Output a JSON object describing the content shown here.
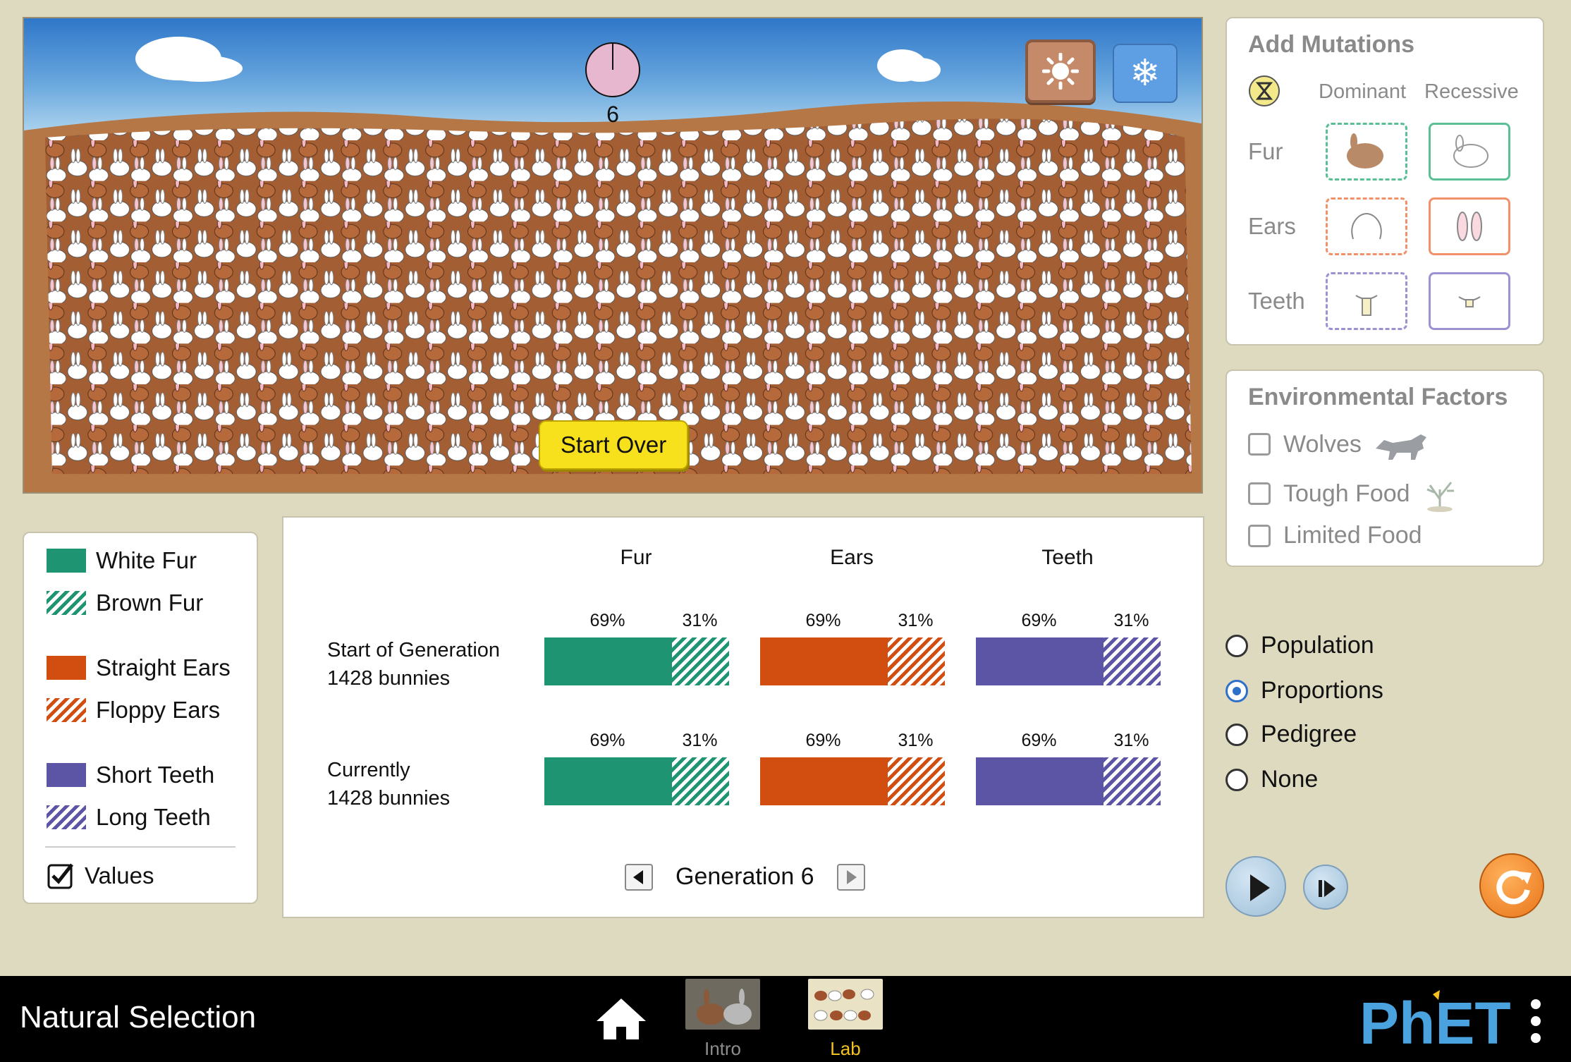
{
  "scene": {
    "generation_clock_value": "6",
    "start_over_label": "Start Over",
    "season_buttons": {
      "summer": "sun-icon",
      "winter": "snowflake-icon"
    }
  },
  "mutations": {
    "title": "Add Mutations",
    "col_dominant": "Dominant",
    "col_recessive": "Recessive",
    "rows": [
      {
        "label": "Fur",
        "color": "#5bbf96"
      },
      {
        "label": "Ears",
        "color": "#f0916a"
      },
      {
        "label": "Teeth",
        "color": "#9c92d2"
      }
    ]
  },
  "environment": {
    "title": "Environmental Factors",
    "items": [
      {
        "label": "Wolves",
        "checked": false
      },
      {
        "label": "Tough Food",
        "checked": false
      },
      {
        "label": "Limited Food",
        "checked": false
      }
    ]
  },
  "view_options": {
    "items": [
      {
        "label": "Population",
        "selected": false
      },
      {
        "label": "Proportions",
        "selected": true
      },
      {
        "label": "Pedigree",
        "selected": false
      },
      {
        "label": "None",
        "selected": false
      }
    ]
  },
  "legend": {
    "items": [
      {
        "label": "White Fur",
        "pattern": "solid",
        "color": "#1f9473"
      },
      {
        "label": "Brown Fur",
        "pattern": "hatch",
        "color": "#1f9473"
      },
      {
        "label": "Straight Ears",
        "pattern": "solid",
        "color": "#d24d10"
      },
      {
        "label": "Floppy Ears",
        "pattern": "hatch",
        "color": "#d24d10"
      },
      {
        "label": "Short Teeth",
        "pattern": "solid",
        "color": "#5c54a4"
      },
      {
        "label": "Long Teeth",
        "pattern": "hatch",
        "color": "#5c54a4"
      }
    ],
    "values_label": "Values",
    "values_checked": true
  },
  "proportions": {
    "columns": [
      "Fur",
      "Ears",
      "Teeth"
    ],
    "rows": [
      {
        "title": "Start of Generation",
        "count": "1428 bunnies",
        "bars": [
          {
            "dominant_pct": 69,
            "recessive_pct": 31,
            "dominant_label": "69%",
            "recessive_label": "31%"
          },
          {
            "dominant_pct": 69,
            "recessive_pct": 31,
            "dominant_label": "69%",
            "recessive_label": "31%"
          },
          {
            "dominant_pct": 69,
            "recessive_pct": 31,
            "dominant_label": "69%",
            "recessive_label": "31%"
          }
        ]
      },
      {
        "title": "Currently",
        "count": "1428 bunnies",
        "bars": [
          {
            "dominant_pct": 69,
            "recessive_pct": 31,
            "dominant_label": "69%",
            "recessive_label": "31%"
          },
          {
            "dominant_pct": 69,
            "recessive_pct": 31,
            "dominant_label": "69%",
            "recessive_label": "31%"
          },
          {
            "dominant_pct": 69,
            "recessive_pct": 31,
            "dominant_label": "69%",
            "recessive_label": "31%"
          }
        ]
      }
    ],
    "generation_label": "Generation 6"
  },
  "navbar": {
    "app_title": "Natural Selection",
    "home_icon": "home-icon",
    "screens": [
      {
        "label": "Intro",
        "active": false,
        "color": "#8c8c8c"
      },
      {
        "label": "Lab",
        "active": true,
        "color": "#f4c21d"
      }
    ],
    "brand": "PhET",
    "menu_icon": "kebab-menu-icon"
  }
}
